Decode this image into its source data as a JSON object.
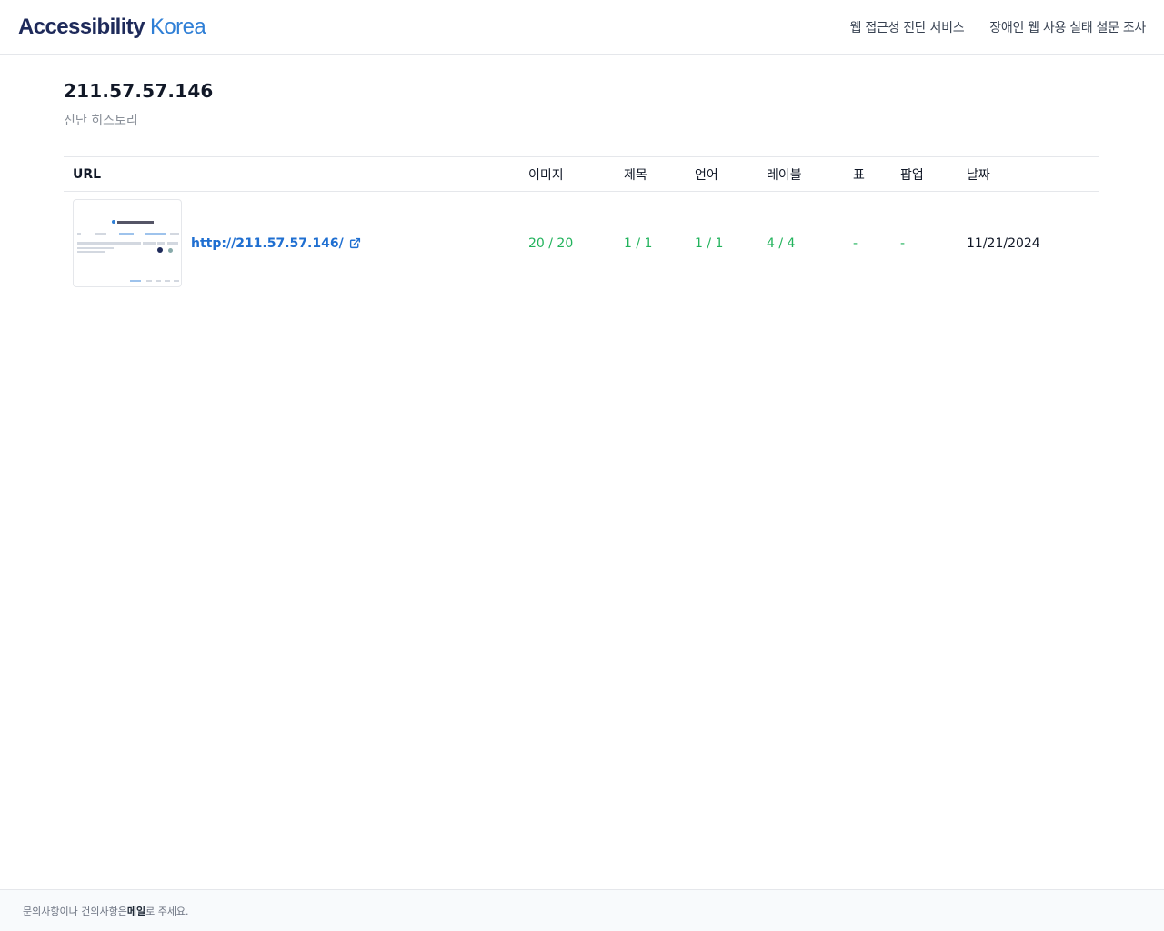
{
  "header": {
    "logo_bold": "Accessibility",
    "logo_light": " Korea",
    "nav": [
      "웹 접근성 진단 서비스",
      "장애인 웹 사용 실태 설문 조사"
    ]
  },
  "site": {
    "title": "211.57.57.146",
    "subtitle": "진단 히스토리"
  },
  "table": {
    "headers": [
      "URL",
      "이미지",
      "제목",
      "언어",
      "레이블",
      "표",
      "팝업",
      "날짜"
    ],
    "rows": [
      {
        "url": "http://211.57.57.146/",
        "images": "20 / 20",
        "title": "1 / 1",
        "language": "1 / 1",
        "label": "4 / 4",
        "table": "-",
        "popup": "-",
        "date": "11/21/2024"
      }
    ]
  },
  "footer": {
    "pre": "문의사항이나 건의사항은 ",
    "link": "메일",
    "post": "로 주세요."
  },
  "colors": {
    "brand_dark": "#1e2a5a",
    "brand_light": "#2f7fd6",
    "link": "#1f6fd1",
    "success": "#22b35c"
  },
  "icons": {
    "external_link": "external-link-icon"
  }
}
